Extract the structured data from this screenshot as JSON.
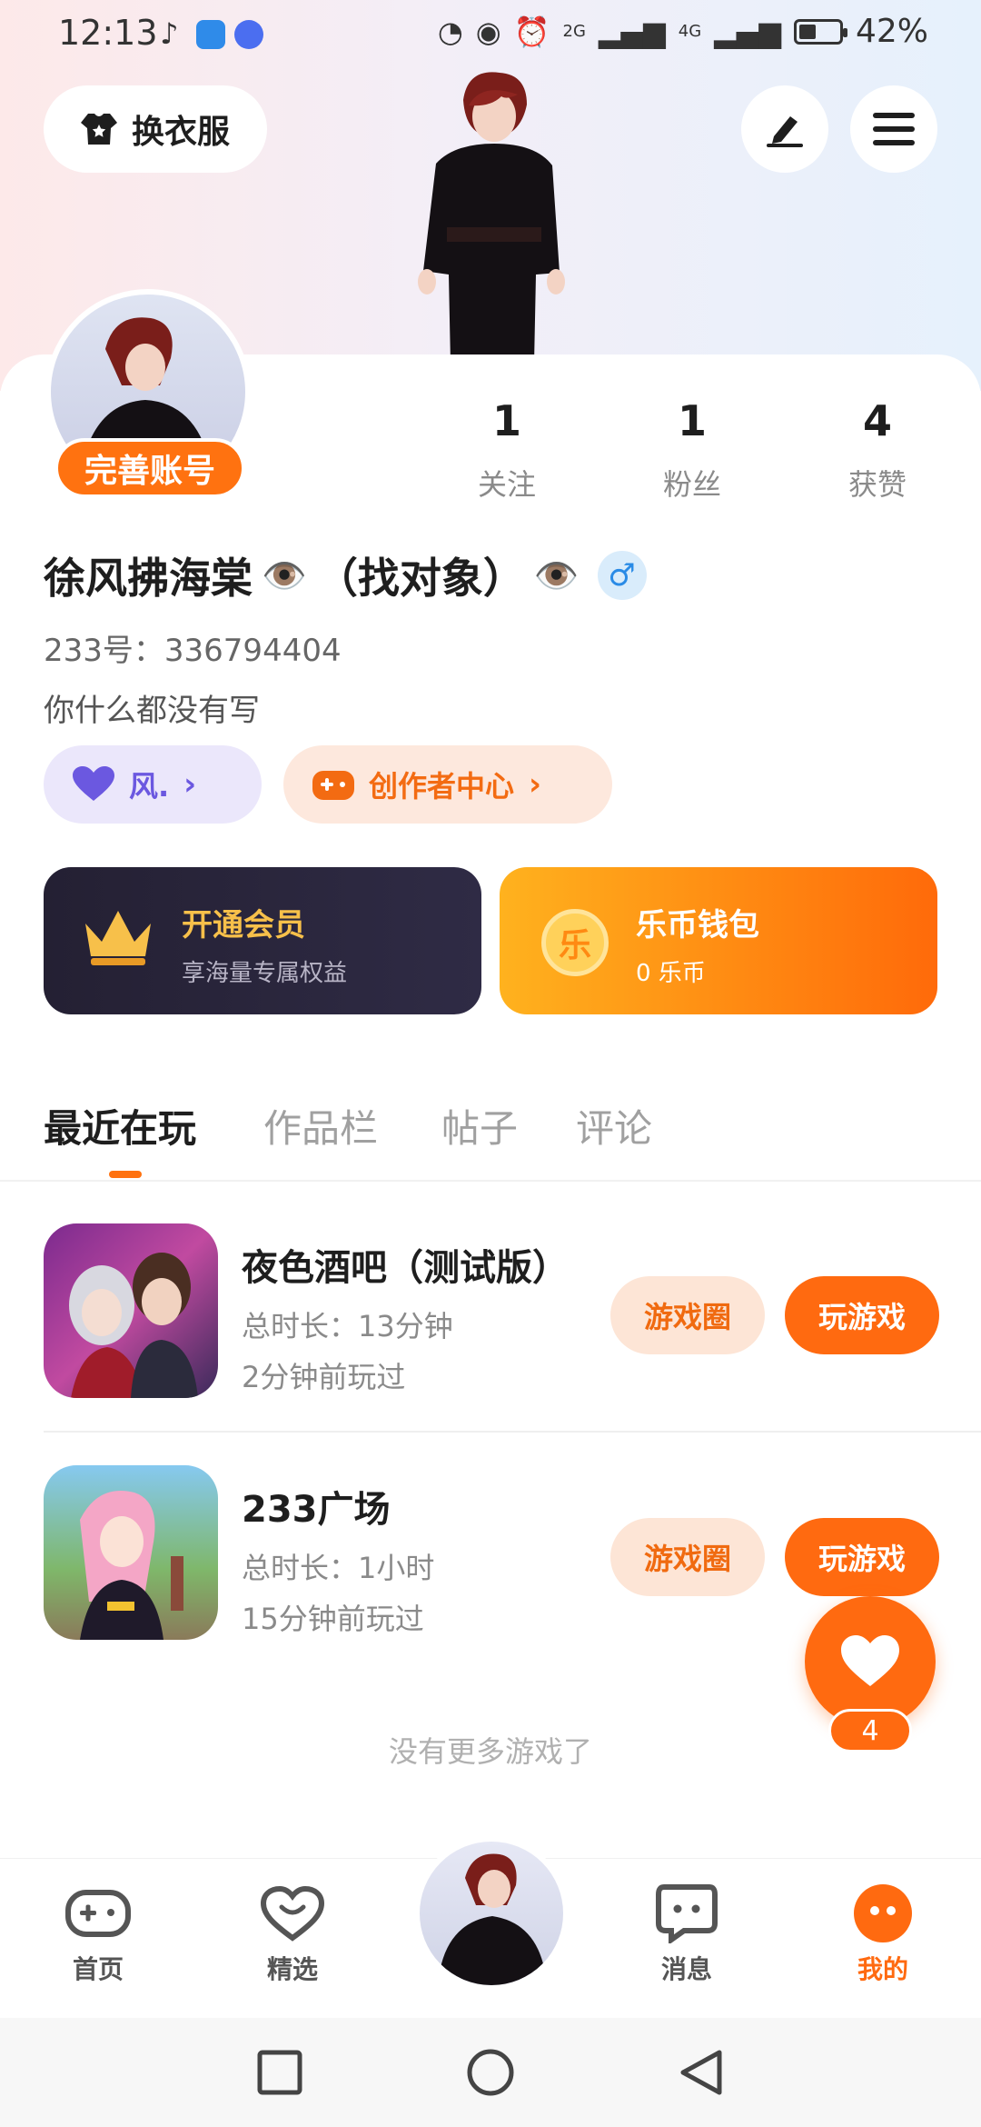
{
  "status_bar": {
    "time": "12:13",
    "battery": "42%",
    "battery_level": 0.42,
    "signal_1": "2G",
    "signal_2": "4G"
  },
  "header": {
    "outfit_label": "换衣服",
    "edit_icon": "edit-icon",
    "menu_icon": "menu-icon"
  },
  "profile": {
    "complete_badge": "完善账号",
    "name": "徐风拂海棠",
    "name_suffix": "（找对象）",
    "eye_glyph": "👁️",
    "gender": "♂",
    "uid_label": "233号：",
    "uid": "336794404",
    "bio": "你什么都没有写",
    "stats": [
      {
        "value": "1",
        "label": "关注"
      },
      {
        "value": "1",
        "label": "粉丝"
      },
      {
        "value": "4",
        "label": "获赞"
      }
    ]
  },
  "pills": {
    "feng": "风.",
    "creator": "创作者中心"
  },
  "cards": {
    "vip_title": "开通会员",
    "vip_sub": "享海量专属权益",
    "coin_title": "乐币钱包",
    "coin_sub": "0 乐币",
    "coin_glyph": "乐"
  },
  "tabs": [
    "最近在玩",
    "作品栏",
    "帖子",
    "评论"
  ],
  "games": [
    {
      "title": "夜色酒吧（测试版）",
      "duration": "总时长：13分钟",
      "last_played": "2分钟前玩过",
      "circle_label": "游戏圈",
      "play_label": "玩游戏"
    },
    {
      "title": "233广场",
      "duration": "总时长：1小时",
      "last_played": "15分钟前玩过",
      "circle_label": "游戏圈",
      "play_label": "玩游戏"
    }
  ],
  "like_count": "4",
  "no_more": "没有更多游戏了",
  "nav": [
    {
      "label": "首页",
      "icon": "gamepad-icon"
    },
    {
      "label": "精选",
      "icon": "heart-chat-icon"
    },
    {
      "label": "消息",
      "icon": "message-icon"
    },
    {
      "label": "我的",
      "icon": "profile-face-icon"
    }
  ],
  "colors": {
    "accent": "#ff6a10",
    "vip_dark": "#2a263b",
    "purple": "#6b58e0"
  }
}
